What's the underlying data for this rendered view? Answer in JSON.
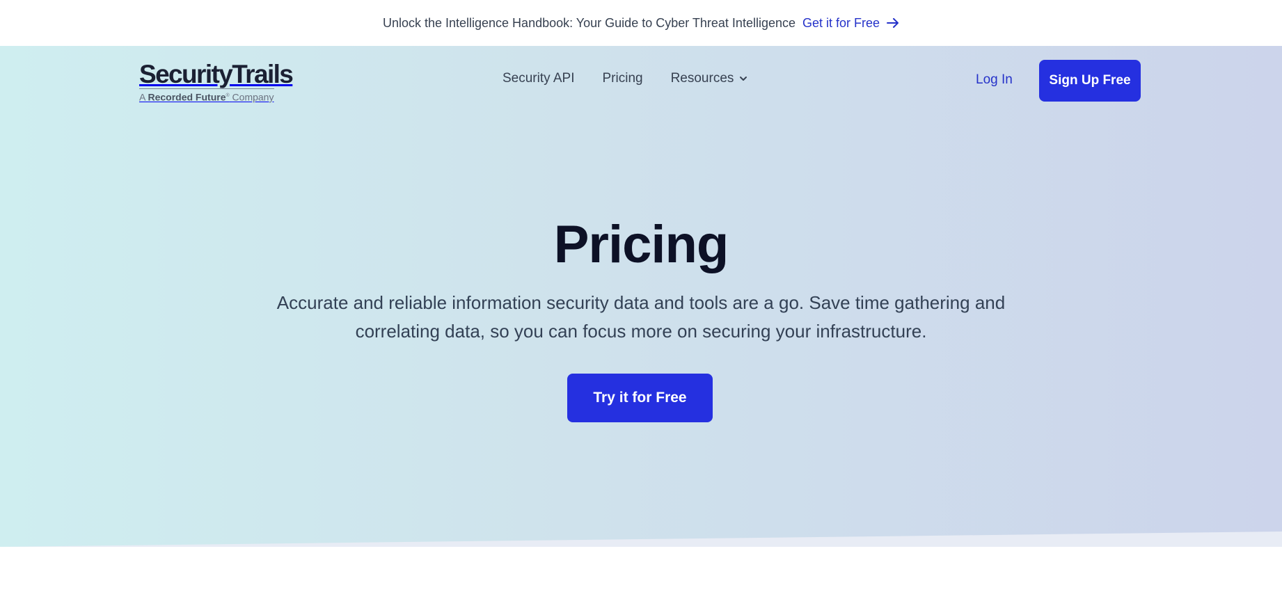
{
  "announcement": {
    "message": "Unlock the Intelligence Handbook: Your Guide to Cyber Threat Intelligence",
    "link_label": "Get it for Free",
    "link_icon": "arrow-right-icon"
  },
  "header": {
    "logo": {
      "brand": "SecurityTrails",
      "tagline_prefix": "A",
      "tagline_brand": "Recorded Future",
      "tagline_suffix": "Company"
    },
    "nav": [
      {
        "label": "Security API"
      },
      {
        "label": "Pricing"
      },
      {
        "label": "Resources",
        "icon": "chevron-down-icon"
      }
    ],
    "login_label": "Log In",
    "signup_label": "Sign Up Free"
  },
  "hero": {
    "title": "Pricing",
    "subtitle": "Accurate and reliable information security data and tools are a go. Save time gathering and correlating data, so you can focus more on securing your infrastructure.",
    "cta_label": "Try it for Free"
  },
  "colors": {
    "accent": "#2530e0",
    "link": "#2532c9",
    "heading": "#0d1126"
  }
}
